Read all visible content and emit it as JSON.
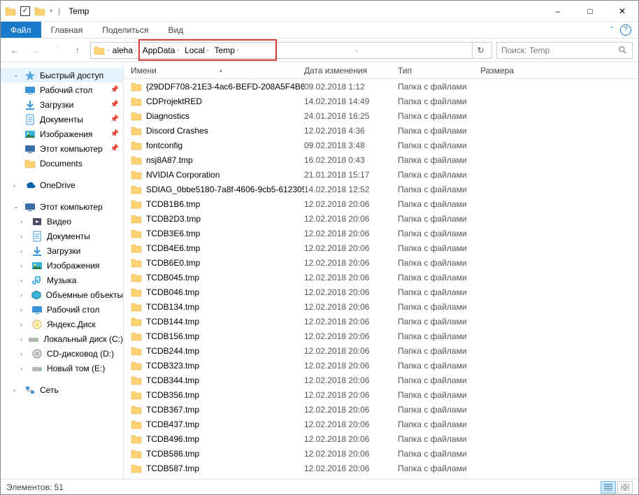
{
  "window": {
    "title": "Temp",
    "controls": {
      "minimize": "–",
      "maximize": "□",
      "close": "✕"
    }
  },
  "ribbon": {
    "file": "Файл",
    "tabs": [
      "Главная",
      "Поделиться",
      "Вид"
    ],
    "expand": "ˇ"
  },
  "nav": {
    "back": "←",
    "forward": "→",
    "recent": "ˇ",
    "up": "↑",
    "breadcrumb": [
      "aleha",
      "AppData",
      "Local",
      "Temp"
    ],
    "refresh": "↻",
    "search_placeholder": "Поиск: Temp"
  },
  "sidebar": {
    "quick_access": "Быстрый доступ",
    "quick_items": [
      {
        "label": "Рабочий стол",
        "icon": "desktop",
        "pin": true
      },
      {
        "label": "Загрузки",
        "icon": "downloads",
        "pin": true
      },
      {
        "label": "Документы",
        "icon": "documents",
        "pin": true
      },
      {
        "label": "Изображения",
        "icon": "pictures",
        "pin": true
      },
      {
        "label": "Этот компьютер",
        "icon": "thispc",
        "pin": true
      },
      {
        "label": "Documents",
        "icon": "folder",
        "pin": false
      }
    ],
    "onedrive": "OneDrive",
    "thispc": "Этот компьютер",
    "thispc_items": [
      {
        "label": "Видео",
        "icon": "video"
      },
      {
        "label": "Документы",
        "icon": "documents"
      },
      {
        "label": "Загрузки",
        "icon": "downloads"
      },
      {
        "label": "Изображения",
        "icon": "pictures"
      },
      {
        "label": "Музыка",
        "icon": "music"
      },
      {
        "label": "Объемные объекты",
        "icon": "3d"
      },
      {
        "label": "Рабочий стол",
        "icon": "desktop"
      },
      {
        "label": "Яндекс.Диск",
        "icon": "yadisk"
      },
      {
        "label": "Локальный диск (C:)",
        "icon": "drive"
      },
      {
        "label": "CD-дисковод (D:)",
        "icon": "cd"
      },
      {
        "label": "Новый том (E:)",
        "icon": "drive"
      }
    ],
    "network": "Сеть"
  },
  "columns": {
    "name": "Имени",
    "date": "Дата изменения",
    "type": "Тип",
    "size": "Размера"
  },
  "folder_type_label": "Папка с файлами",
  "files": [
    {
      "name": "{29DDF708-21E3-4ac6-BEFD-208A5F4B6B...",
      "date": "09.02.2018 1:12"
    },
    {
      "name": "CDProjektRED",
      "date": "14.02.2018 14:49"
    },
    {
      "name": "Diagnostics",
      "date": "24.01.2018 16:25"
    },
    {
      "name": "Discord Crashes",
      "date": "12.02.2018 4:36"
    },
    {
      "name": "fontconfig",
      "date": "09.02.2018 3:48"
    },
    {
      "name": "nsj8A87.tmp",
      "date": "16.02.2018 0:43"
    },
    {
      "name": "NVIDIA Corporation",
      "date": "21.01.2018 15:17"
    },
    {
      "name": "SDIAG_0bbe5180-7a8f-4606-9cb5-612305...",
      "date": "14.02.2018 12:52"
    },
    {
      "name": "TCDB1B6.tmp",
      "date": "12.02.2018 20:06"
    },
    {
      "name": "TCDB2D3.tmp",
      "date": "12.02.2018 20:06"
    },
    {
      "name": "TCDB3E6.tmp",
      "date": "12.02.2018 20:06"
    },
    {
      "name": "TCDB4E6.tmp",
      "date": "12.02.2018 20:06"
    },
    {
      "name": "TCDB6E0.tmp",
      "date": "12.02.2018 20:06"
    },
    {
      "name": "TCDB045.tmp",
      "date": "12.02.2018 20:06"
    },
    {
      "name": "TCDB046.tmp",
      "date": "12.02.2018 20:06"
    },
    {
      "name": "TCDB134.tmp",
      "date": "12.02.2018 20:06"
    },
    {
      "name": "TCDB144.tmp",
      "date": "12.02.2018 20:06"
    },
    {
      "name": "TCDB156.tmp",
      "date": "12.02.2018 20:06"
    },
    {
      "name": "TCDB244.tmp",
      "date": "12.02.2018 20:06"
    },
    {
      "name": "TCDB323.tmp",
      "date": "12.02.2018 20:06"
    },
    {
      "name": "TCDB344.tmp",
      "date": "12.02.2018 20:06"
    },
    {
      "name": "TCDB356.tmp",
      "date": "12.02.2018 20:06"
    },
    {
      "name": "TCDB367.tmp",
      "date": "12.02.2018 20:06"
    },
    {
      "name": "TCDB437.tmp",
      "date": "12.02.2018 20:06"
    },
    {
      "name": "TCDB496.tmp",
      "date": "12.02.2018 20:06"
    },
    {
      "name": "TCDB586.tmp",
      "date": "12.02.2018 20:06"
    },
    {
      "name": "TCDB587.tmp",
      "date": "12.02.2018 20:06"
    }
  ],
  "status": {
    "count_label": "Элементов: 51"
  }
}
